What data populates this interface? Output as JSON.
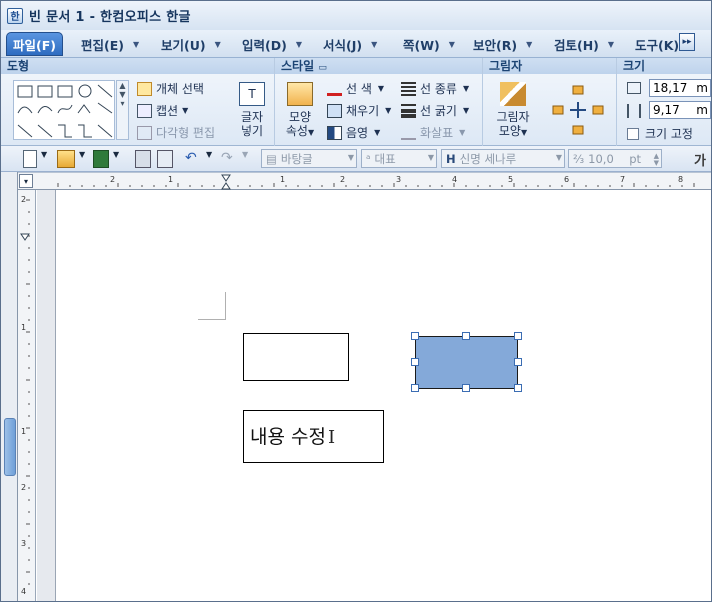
{
  "window": {
    "title": "빈 문서 1 - 한컴오피스 한글",
    "app_icon": "hwp-app-icon"
  },
  "menu": {
    "tabs": [
      {
        "label": "파일(F)"
      },
      {
        "label": "편집(E)"
      },
      {
        "label": "보기(U)"
      },
      {
        "label": "입력(D)"
      },
      {
        "label": "서식(J)"
      },
      {
        "label": "쪽(W)"
      },
      {
        "label": "보안(R)"
      },
      {
        "label": "검토(H)"
      },
      {
        "label": "도구(K)"
      }
    ],
    "active_index": 0
  },
  "ribbon": {
    "shape_group": {
      "title": "도형",
      "select_object": "개체 선택",
      "caption": "캡션",
      "polygon_edit": "다각형 편집"
    },
    "textbox": {
      "line1": "글자",
      "line2": "넣기"
    },
    "style_group": {
      "title": "스타일",
      "shape_props_line1": "모양",
      "shape_props_line2": "속성",
      "line_color": "선 색",
      "fill": "채우기",
      "shadow": "음영",
      "line_type": "선 종류",
      "line_thickness": "선 굵기",
      "arrow": "화살표"
    },
    "shadow_group": {
      "title": "그림자",
      "label_line1": "그림자",
      "label_line2": "모양"
    },
    "size_group": {
      "title": "크기",
      "width_value": "18,17",
      "height_value": "9,17",
      "unit": "m",
      "lock_size": "크기 고정"
    }
  },
  "toolbar": {
    "style_combo": "바탕글",
    "lang_combo": "대표",
    "font_combo": "신명 세나루",
    "size_value": "10,0",
    "size_unit": "pt",
    "bold_label": "가"
  },
  "document": {
    "textbox_content": "내용 수정",
    "cursor_glyph": "I"
  },
  "ruler": {
    "top_labels": [
      "2",
      "1",
      "1",
      "2",
      "3",
      "4",
      "5",
      "6",
      "7",
      "8"
    ],
    "left_labels": [
      "2",
      "1",
      "1",
      "2",
      "3",
      "4"
    ]
  },
  "colors": {
    "selected_shape_fill": "#84a9d9",
    "handle_color": "#3b6db3",
    "active_tab": "#2e6cc0"
  }
}
